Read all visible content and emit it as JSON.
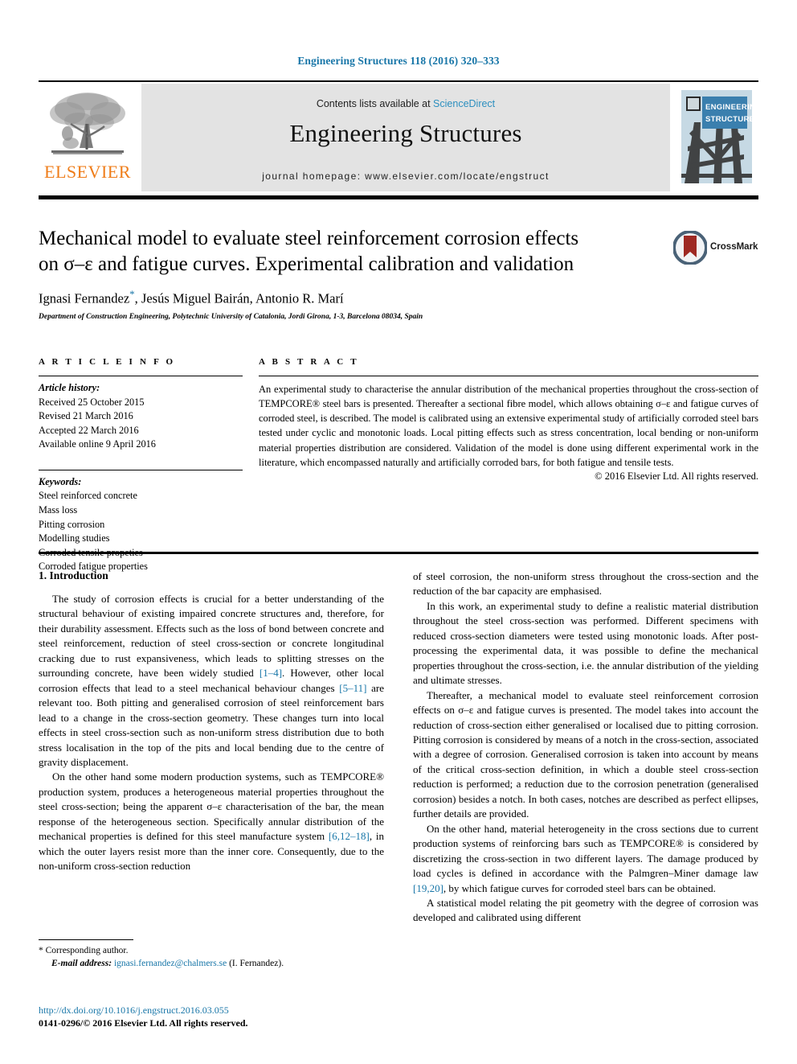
{
  "colors": {
    "link_blue": "#1876a8",
    "science_direct_blue": "#2c8fbf",
    "elsevier_orange": "#ef7d1a",
    "masthead_gray": "#e3e3e3",
    "crossmark_circle": "#4a6277",
    "crossmark_bookmark": "#9e2a24",
    "cover_blue": "#3a7fae"
  },
  "running_head": "Engineering Structures 118 (2016) 320–333",
  "masthead": {
    "publisher_logo_text": "ELSEVIER",
    "contents_prefix": "Contents lists available at ",
    "contents_link": "ScienceDirect",
    "journal_name": "Engineering Structures",
    "homepage": "journal homepage: www.elsevier.com/locate/engstruct",
    "cover_title_line1": "ENGINEERING",
    "cover_title_line2": "STRUCTURES"
  },
  "title_block": {
    "title_line1": "Mechanical model to evaluate steel reinforcement corrosion effects",
    "title_line2": "on σ–ε and fatigue curves. Experimental calibration and validation",
    "authors": "Ignasi Fernandez , Jesús Miguel Bairán, Antonio R. Marí",
    "author_star": "*",
    "affiliation": "Department of Construction Engineering, Polytechnic University of Catalonia, Jordi Girona, 1-3, Barcelona 08034, Spain",
    "crossmark_label": "CrossMark"
  },
  "article_info": {
    "heading": "A R T I C L E   I N F O",
    "history_label": "Article history:",
    "history": [
      "Received 25 October 2015",
      "Revised 21 March 2016",
      "Accepted 22 March 2016",
      "Available online 9 April 2016"
    ],
    "keywords_label": "Keywords:",
    "keywords": [
      "Steel reinforced concrete",
      "Mass loss",
      "Pitting corrosion",
      "Modelling studies",
      "Corroded tensile propeties",
      "Corroded fatigue properties"
    ]
  },
  "abstract": {
    "heading": "A B S T R A C T",
    "text": "An experimental study to characterise the annular distribution of the mechanical properties throughout the cross-section of TEMPCORE® steel bars is presented. Thereafter a sectional fibre model, which allows obtaining σ–ε and fatigue curves of corroded steel, is described. The model is calibrated using an extensive experimental study of artificially corroded steel bars tested under cyclic and monotonic loads. Local pitting effects such as stress concentration, local bending or non-uniform material properties distribution are considered. Validation of the model is done using different experimental work in the literature, which encompassed naturally and artificially corroded bars, for both fatigue and tensile tests.",
    "copyright": "© 2016 Elsevier Ltd. All rights reserved."
  },
  "body": {
    "section_title": "1. Introduction",
    "left_paragraphs": [
      {
        "parts": [
          {
            "t": "The study of corrosion effects is crucial for a better understanding of the structural behaviour of existing impaired concrete structures and, therefore, for their durability assessment. Effects such as the loss of bond between concrete and steel reinforcement, reduction of steel cross-section or concrete longitudinal cracking due to rust expansiveness, which leads to splitting stresses on the surrounding concrete, have been widely studied ",
            "c": false
          },
          {
            "t": "[1–4]",
            "c": true
          },
          {
            "t": ". However, other local corrosion effects that lead to a steel mechanical behaviour changes ",
            "c": false
          },
          {
            "t": "[5–11]",
            "c": true
          },
          {
            "t": " are relevant too. Both pitting and generalised corrosion of steel reinforcement bars lead to a change in the cross-section geometry. These changes turn into local effects in steel cross-section such as non-uniform stress distribution due to both stress localisation in the top of the pits and local bending due to the centre of gravity displacement.",
            "c": false
          }
        ]
      },
      {
        "parts": [
          {
            "t": "On the other hand some modern production systems, such as TEMPCORE® production system, produces a heterogeneous material properties throughout the steel cross-section; being the apparent σ–ε characterisation of the bar, the mean response of the heterogeneous section. Specifically annular distribution of the mechanical properties is defined for this steel manufacture system ",
            "c": false
          },
          {
            "t": "[6,12–18]",
            "c": true
          },
          {
            "t": ", in which the outer layers resist more than the inner core. Consequently, due to the non-uniform cross-section reduction",
            "c": false
          }
        ]
      }
    ],
    "right_paragraphs": [
      {
        "parts": [
          {
            "t": "of steel corrosion, the non-uniform stress throughout the cross-section and the reduction of the bar capacity are emphasised.",
            "c": false
          }
        ],
        "no_indent": true
      },
      {
        "parts": [
          {
            "t": "In this work, an experimental study to define a realistic material distribution throughout the steel cross-section was performed. Different specimens with reduced cross-section diameters were tested using monotonic loads. After post-processing the experimental data, it was possible to define the mechanical properties throughout the cross-section, i.e. the annular distribution of the yielding and ultimate stresses.",
            "c": false
          }
        ]
      },
      {
        "parts": [
          {
            "t": "Thereafter, a mechanical model to evaluate steel reinforcement corrosion effects on σ–ε and fatigue curves is presented. The model takes into account the reduction of cross-section either generalised or localised due to pitting corrosion. Pitting corrosion is considered by means of a notch in the cross-section, associated with a degree of corrosion. Generalised corrosion is taken into account by means of the critical cross-section definition, in which a double steel cross-section reduction is performed; a reduction due to the corrosion penetration (generalised corrosion) besides a notch. In both cases, notches are described as perfect ellipses, further details are provided.",
            "c": false
          }
        ]
      },
      {
        "parts": [
          {
            "t": "On the other hand, material heterogeneity in the cross sections due to current production systems of reinforcing bars such as TEMPCORE® is considered by discretizing the cross-section in two different layers. The damage produced by load cycles is defined in accordance with the Palmgren–Miner damage law ",
            "c": false
          },
          {
            "t": "[19,20]",
            "c": true
          },
          {
            "t": ", by which fatigue curves for corroded steel bars can be obtained.",
            "c": false
          }
        ]
      },
      {
        "parts": [
          {
            "t": "A statistical model relating the pit geometry with the degree of corrosion was developed and calibrated using different",
            "c": false
          }
        ]
      }
    ]
  },
  "footer": {
    "corresponding_marker": "*",
    "corresponding_text": "Corresponding author.",
    "email_label": "E-mail address:",
    "email": "ignasi.fernandez@chalmers.se",
    "email_suffix": "(I. Fernandez).",
    "doi": "http://dx.doi.org/10.1016/j.engstruct.2016.03.055",
    "issn_line": "0141-0296/© 2016 Elsevier Ltd. All rights reserved."
  }
}
